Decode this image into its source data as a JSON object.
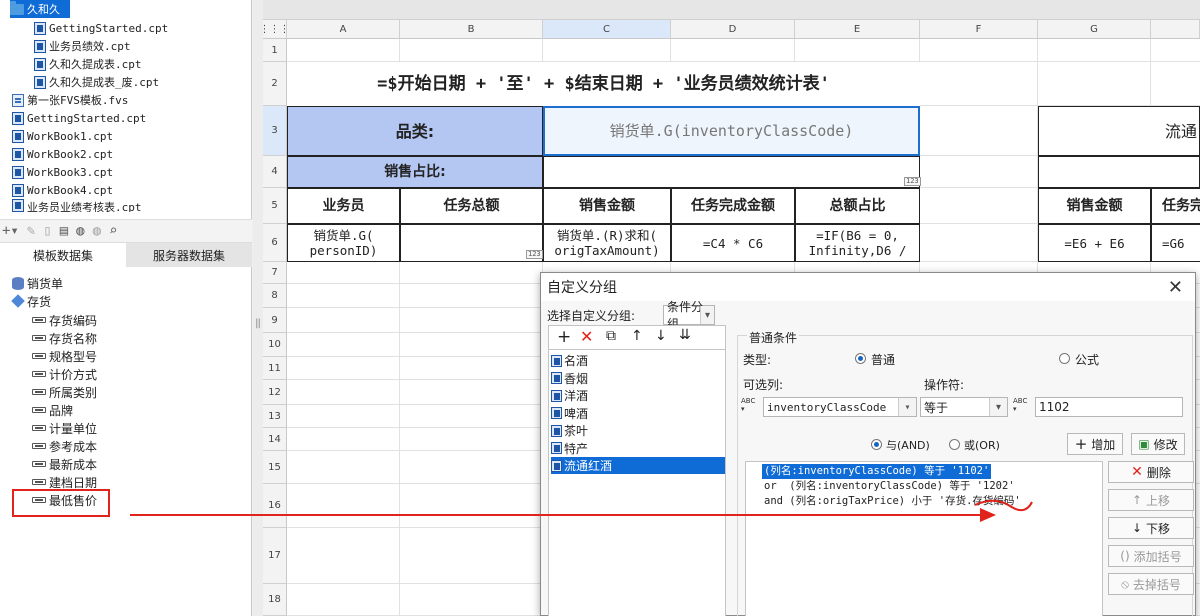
{
  "left_panel": {
    "tree": [
      {
        "label": "久和久",
        "kind": "folder",
        "selected": true
      },
      {
        "label": "GettingStarted.cpt",
        "kind": "file"
      },
      {
        "label": "业务员绩效.cpt",
        "kind": "file"
      },
      {
        "label": "久和久提成表.cpt",
        "kind": "file"
      },
      {
        "label": "久和久提成表_废.cpt",
        "kind": "file"
      },
      {
        "label": "第一张FVS模板.fvs",
        "kind": "fvs"
      },
      {
        "label": "GettingStarted.cpt",
        "kind": "file"
      },
      {
        "label": "WorkBook1.cpt",
        "kind": "file"
      },
      {
        "label": "WorkBook2.cpt",
        "kind": "file"
      },
      {
        "label": "WorkBook3.cpt",
        "kind": "file"
      },
      {
        "label": "WorkBook4.cpt",
        "kind": "file"
      },
      {
        "label": "业务员业绩考核表.cpt",
        "kind": "file"
      }
    ],
    "tabs": {
      "template": "模板数据集",
      "server": "服务器数据集"
    },
    "datasets": [
      {
        "label": "销货单",
        "kind": "db"
      },
      {
        "label": "存货",
        "kind": "cube"
      }
    ],
    "fields": [
      "存货编码",
      "存货名称",
      "规格型号",
      "计价方式",
      "所属类别",
      "品牌",
      "计量单位",
      "参考成本",
      "最新成本",
      "建档日期",
      "最低售价"
    ]
  },
  "sheet": {
    "columns": [
      "A",
      "B",
      "C",
      "D",
      "E",
      "F",
      "G"
    ],
    "rows": [
      "1",
      "2",
      "3",
      "4",
      "5",
      "6",
      "7",
      "8",
      "9",
      "10",
      "11",
      "12",
      "13",
      "14",
      "15",
      "16",
      "17",
      "18"
    ],
    "title": "=$开始日期 + '至' + $结束日期 + '业务员绩效统计表'",
    "category_label": "品类:",
    "category_value": "销货单.G(inventoryClassCode)",
    "ratio_label": "销售占比:",
    "g3_partial": "流通",
    "headers": [
      "业务员",
      "任务总额",
      "销售金额",
      "任务完成金额",
      "总额占比",
      "销售金额",
      "任务完"
    ],
    "row6": [
      "销货单.G(\npersonID)",
      "",
      "销货单.(R)求和(\norigTaxAmount)",
      "=C4 * C6",
      "=IF(B6 = 0,\nInfinity,D6 /",
      "=E6 + E6",
      "=G6"
    ],
    "tag123": "123"
  },
  "dialog": {
    "title": "自定义分组",
    "select_label": "选择自定义分组:",
    "select_value": "条件分组",
    "groups": [
      "名酒",
      "香烟",
      "洋酒",
      "啤酒",
      "茶叶",
      "特产",
      "流通红酒"
    ],
    "selected_group": 6,
    "section_label": "普通条件",
    "type_label": "类型:",
    "type_normal": "普通",
    "type_formula": "公式",
    "column_label": "可选列:",
    "operator_label": "操作符:",
    "column_value": "inventoryClassCode",
    "operator_value": "等于",
    "value": "1102",
    "abc": "ABC",
    "and_label": "与(AND)",
    "or_label": "或(OR)",
    "add_btn": "增加",
    "modify_btn": "修改",
    "delete_btn": "删除",
    "up_btn": "上移",
    "down_btn": "下移",
    "add_paren_btn": "添加括号",
    "remove_paren_btn": "去掉括号",
    "conditions": [
      "(列名:inventoryClassCode) 等于 '1102'",
      "or  (列名:inventoryClassCode) 等于 '1202'",
      "and (列名:origTaxPrice) 小于 '存货.存货编码'"
    ]
  }
}
